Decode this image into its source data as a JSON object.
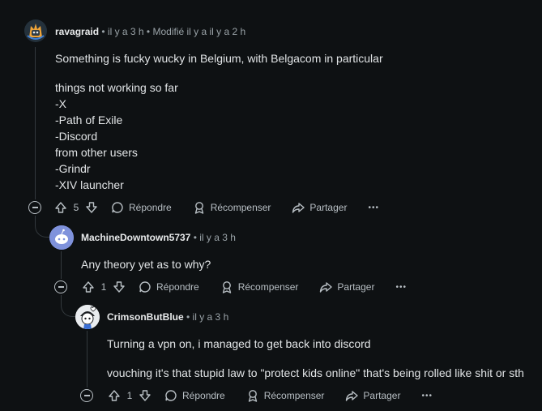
{
  "comments": [
    {
      "author": "ravagraid",
      "meta": "• il y a 3 h • Modifié il y a il y a 2 h",
      "body": [
        "Something is fucky wucky in Belgium, with Belgacom in particular",
        "",
        "things not working so far",
        "-X",
        "-Path of Exile",
        "-Discord",
        "from other users",
        "-Grindr",
        "-XIV launcher"
      ],
      "votes": "5"
    },
    {
      "author": "MachineDowntown5737",
      "meta": "• il y a 3 h",
      "body": [
        "Any theory yet as to why?"
      ],
      "votes": "1"
    },
    {
      "author": "CrimsonButBlue",
      "meta": "• il y a 3 h",
      "body": [
        "Turning a vpn on, i managed to get back into discord",
        "",
        "vouching it's that stupid law to \"protect kids online\" that's being rolled like shit or sth"
      ],
      "votes": "1"
    }
  ],
  "actions": {
    "reply": "Répondre",
    "award": "Récompenser",
    "share": "Partager",
    "more": "•••"
  },
  "colors": {
    "background": "#0e1113",
    "text": "#d7dadc",
    "muted": "#9aa3a8",
    "thread_line": "#33393d"
  }
}
